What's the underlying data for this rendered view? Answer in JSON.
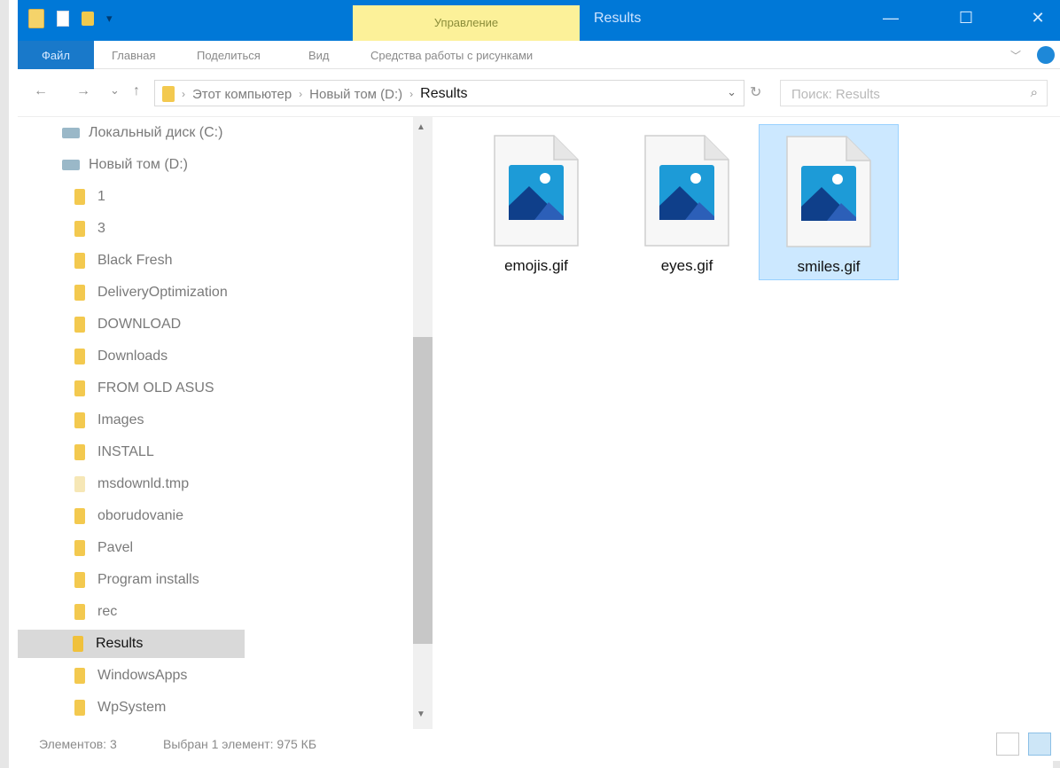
{
  "titlebar": {
    "manage_tab": "Управление",
    "window_title": "Results",
    "minimize": "—",
    "maximize": "☐",
    "close": "✕"
  },
  "ribbon": {
    "file": "Файл",
    "tabs": [
      "Главная",
      "Поделиться",
      "Вид",
      "Средства работы с рисунками"
    ]
  },
  "navbar": {
    "back": "←",
    "forward": "→",
    "recent": "⌄",
    "up": "↑",
    "breadcrumbs": [
      "Этот компьютер",
      "Новый том (D:)",
      "Results"
    ],
    "separator": "›",
    "search_placeholder": "Поиск: Results"
  },
  "navpane": {
    "items": [
      {
        "label": "Локальный диск (C:)",
        "type": "drive"
      },
      {
        "label": "Новый том (D:)",
        "type": "drive"
      },
      {
        "label": "1",
        "type": "folder"
      },
      {
        "label": "3",
        "type": "folder"
      },
      {
        "label": "Black Fresh",
        "type": "folder"
      },
      {
        "label": "DeliveryOptimization",
        "type": "folder"
      },
      {
        "label": "DOWNLOAD",
        "type": "folder"
      },
      {
        "label": "Downloads",
        "type": "folder"
      },
      {
        "label": "FROM OLD ASUS",
        "type": "folder"
      },
      {
        "label": "Images",
        "type": "folder"
      },
      {
        "label": "INSTALL",
        "type": "folder"
      },
      {
        "label": "msdownld.tmp",
        "type": "folder-pale"
      },
      {
        "label": "oborudovanie",
        "type": "folder"
      },
      {
        "label": "Pavel",
        "type": "folder"
      },
      {
        "label": "Program installs",
        "type": "folder"
      },
      {
        "label": "rec",
        "type": "folder"
      },
      {
        "label": "Results",
        "type": "folder",
        "selected": true
      },
      {
        "label": "WindowsApps",
        "type": "folder"
      },
      {
        "label": "WpSystem",
        "type": "folder"
      }
    ]
  },
  "content": {
    "files": [
      {
        "name": "emojis.gif",
        "icon": "image-file-icon",
        "selected": false
      },
      {
        "name": "eyes.gif",
        "icon": "image-file-icon",
        "selected": false
      },
      {
        "name": "smiles.gif",
        "icon": "image-file-icon",
        "selected": true
      }
    ]
  },
  "statusbar": {
    "items_count": "Элементов: 3",
    "selected_info": "Выбран 1 элемент: 975 КБ"
  }
}
